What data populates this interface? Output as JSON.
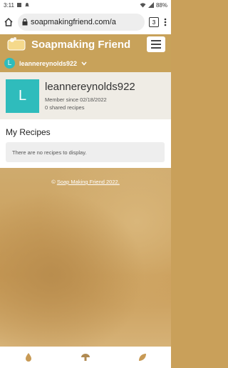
{
  "status_bar": {
    "time": "3:11",
    "battery": "88%"
  },
  "browser": {
    "url": "soapmakingfriend.com/a",
    "tab_count": "3"
  },
  "app": {
    "brand": "Soapmaking Friend"
  },
  "user": {
    "initial": "L",
    "username": "leannereynolds922"
  },
  "profile": {
    "name": "leannereynolds922",
    "member_since": "Member since 02/18/2022",
    "shared_recipes": "0 shared recipes"
  },
  "recipes": {
    "title": "My Recipes",
    "empty_message": "There are no recipes to display."
  },
  "footer": {
    "copyright_symbol": "©",
    "copyright_link": "Soap Making Friend 2022."
  },
  "colors": {
    "brand": "#c8a25a",
    "avatar": "#2fbcbc"
  }
}
